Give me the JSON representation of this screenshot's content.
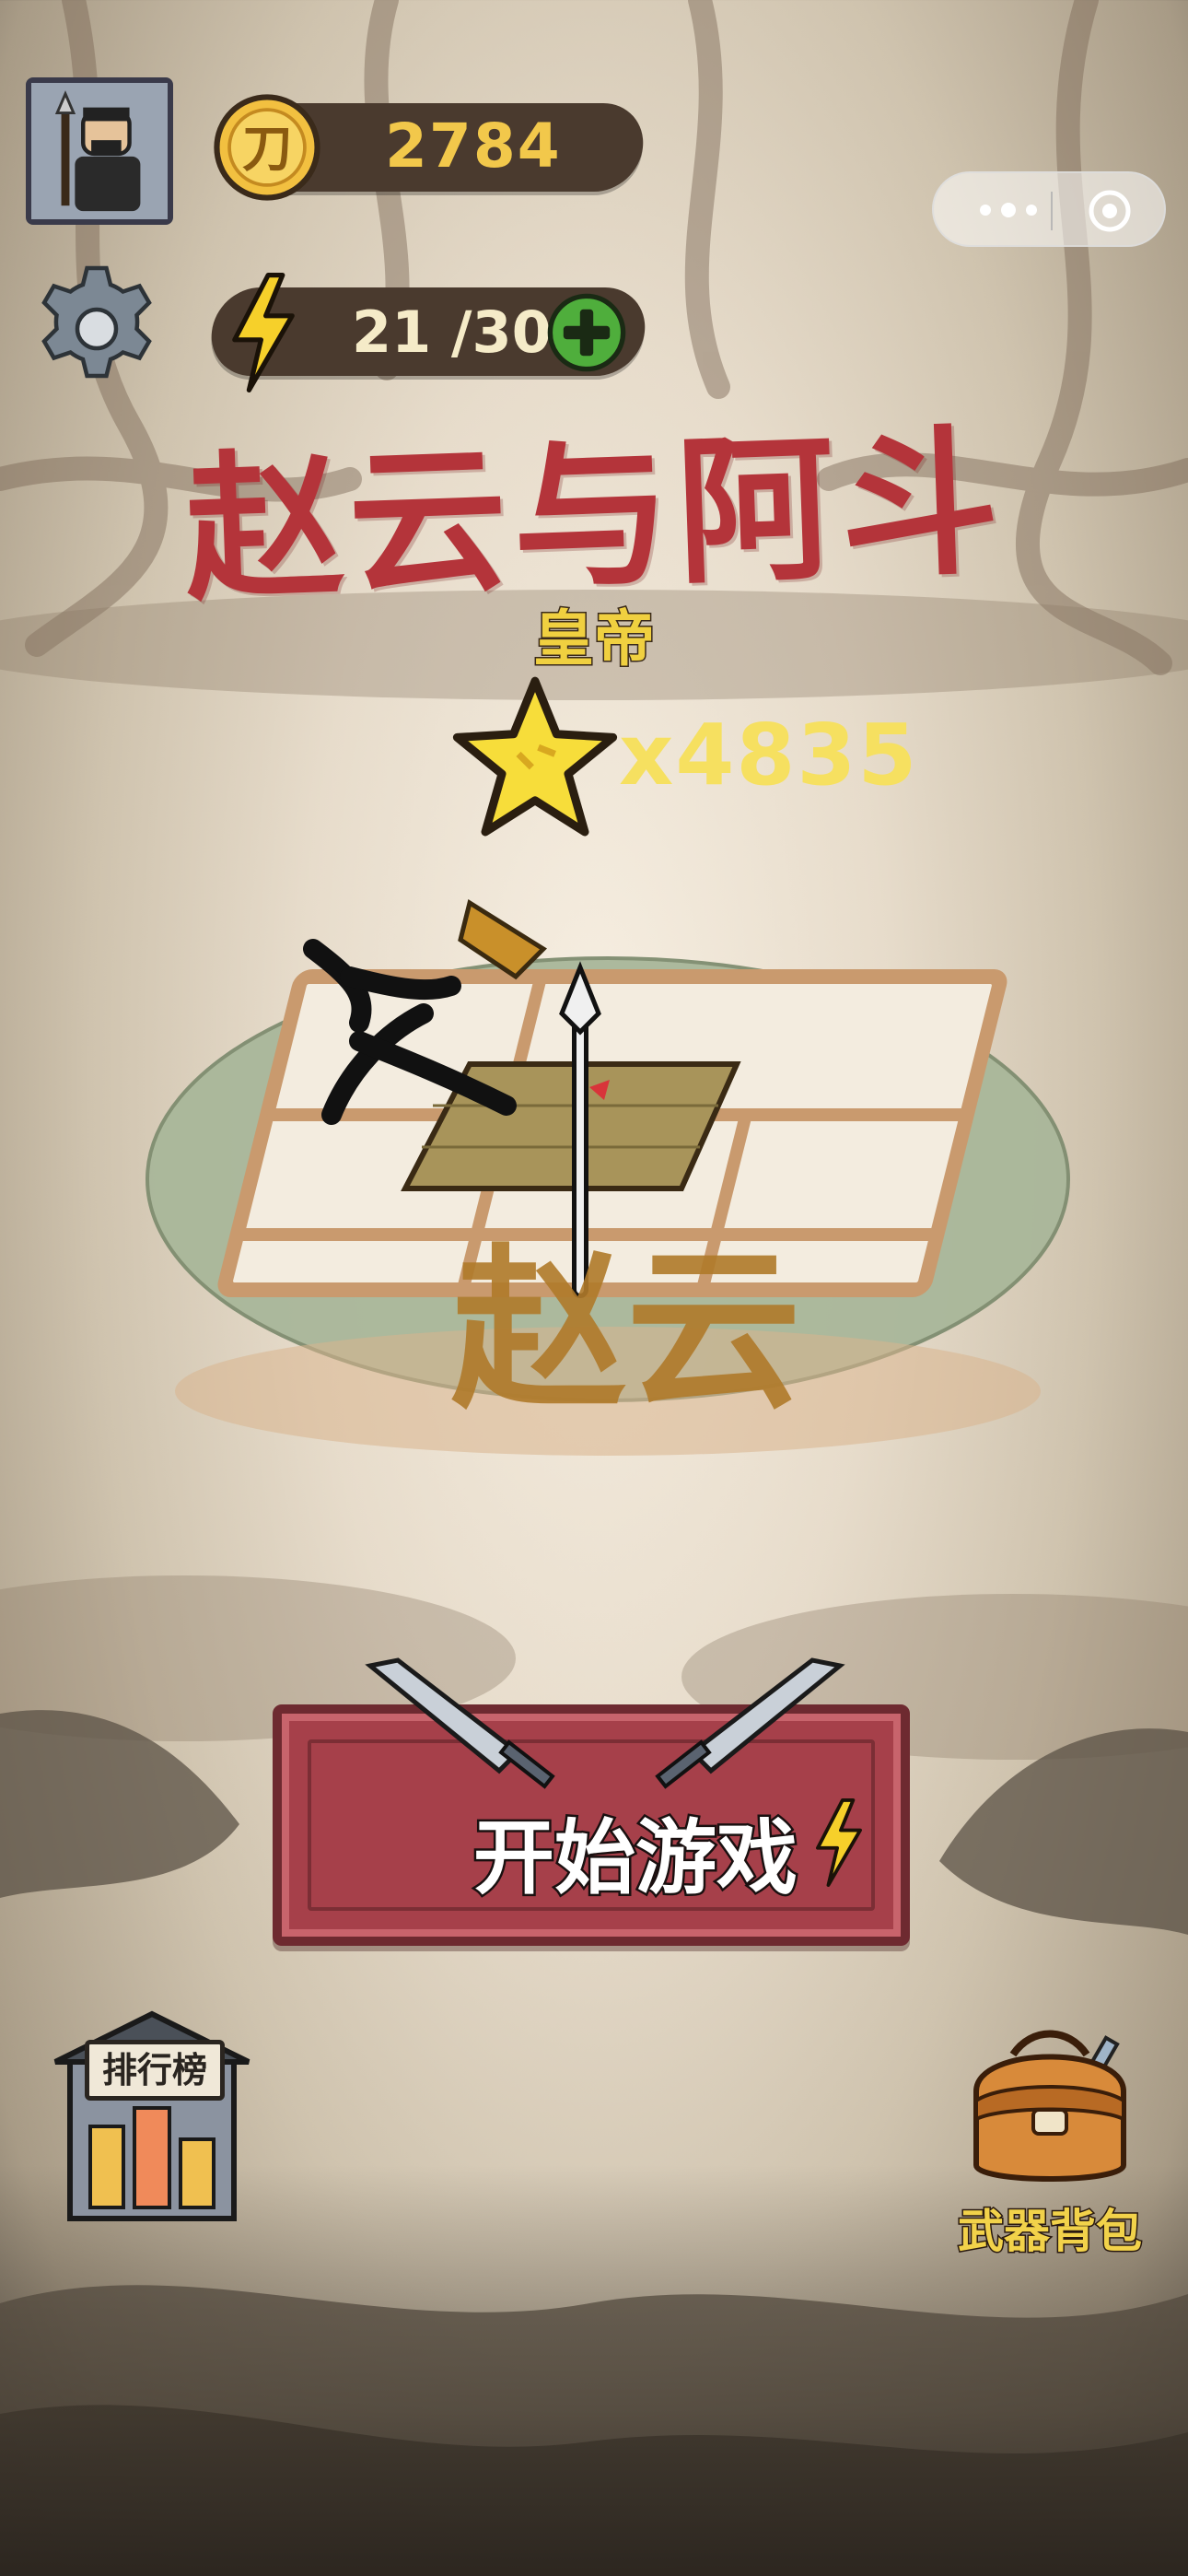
{
  "hud": {
    "coins": "2784",
    "energy_current": "21",
    "energy_max": "/30"
  },
  "level": {
    "title": "赵云与阿斗",
    "rank": "皇帝",
    "stars_count": "x4835",
    "art_text": "赵云"
  },
  "actions": {
    "start_label": "开始游戏",
    "leaderboard_label": "排行榜",
    "backpack_label": "武器背包"
  },
  "icons": {
    "avatar": "warrior-avatar-icon",
    "coin": "dao-coin-icon",
    "energy": "lightning-bolt-icon",
    "add": "plus-icon",
    "settings": "gear-icon",
    "menu": "more-dots-icon",
    "close": "target-circle-icon",
    "star": "star-icon",
    "swords": "crossed-swords-icon",
    "leaderboard": "building-icon",
    "backpack": "backpack-icon"
  },
  "colors": {
    "title": "#b4343a",
    "gold": "#f2c84b",
    "button": "#a6404a",
    "rank": "#f0d040"
  }
}
